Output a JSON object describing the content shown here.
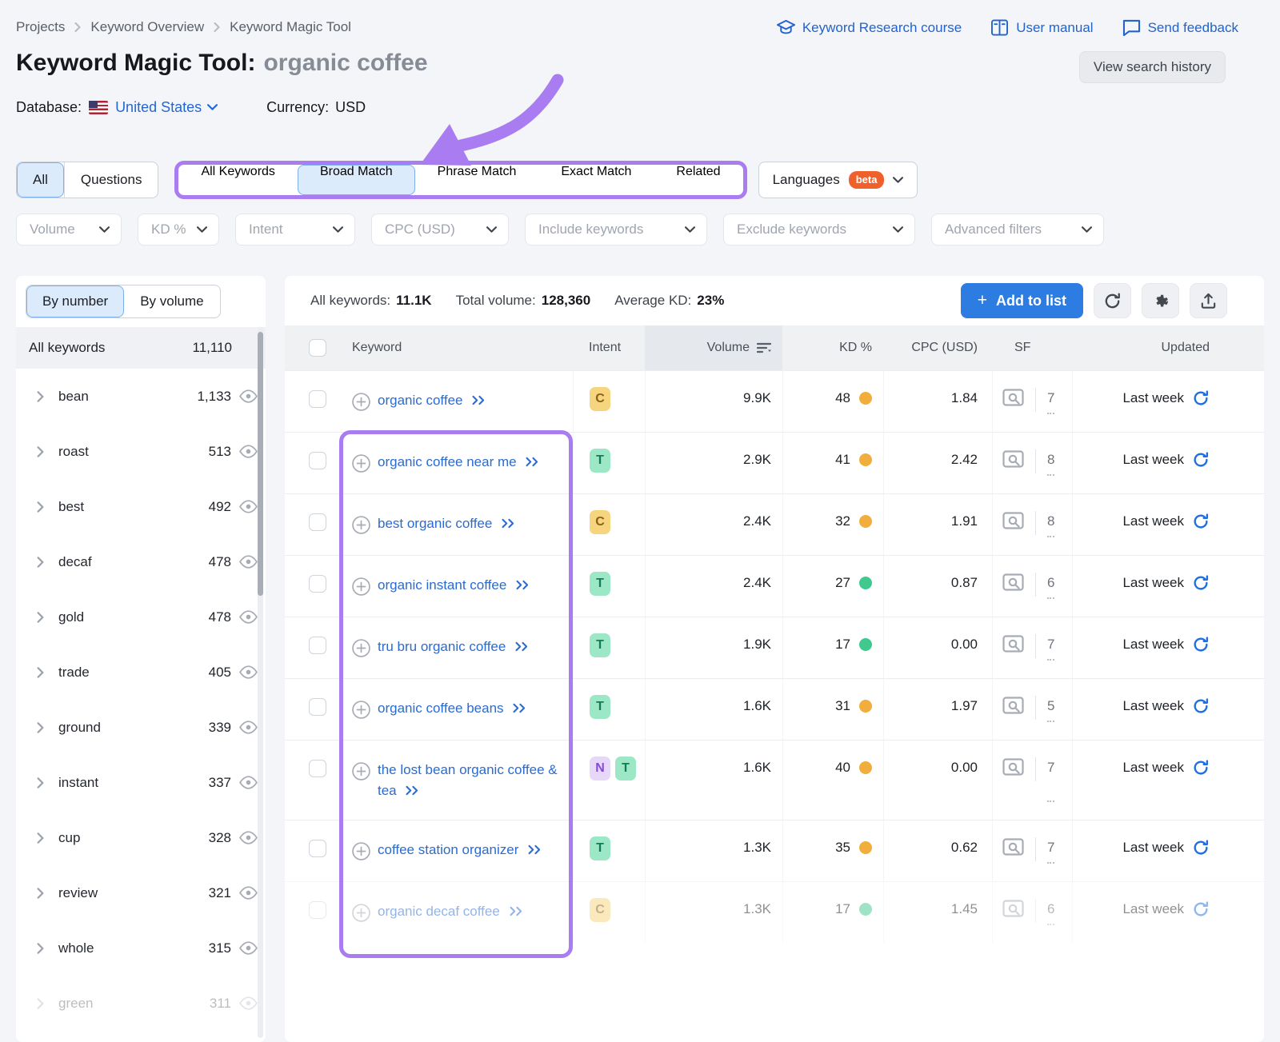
{
  "breadcrumb": {
    "items": [
      "Projects",
      "Keyword Overview",
      "Keyword Magic Tool"
    ]
  },
  "header": {
    "links": [
      {
        "label": "Keyword Research course",
        "icon": "graduation-cap-icon"
      },
      {
        "label": "User manual",
        "icon": "book-icon"
      },
      {
        "label": "Send feedback",
        "icon": "chat-icon"
      }
    ],
    "title": "Keyword Magic Tool:",
    "query": "organic coffee",
    "view_history_label": "View search history",
    "database_label": "Database:",
    "database_value": "United States",
    "currency_label": "Currency:",
    "currency_value": "USD"
  },
  "tabs": {
    "question_group": [
      {
        "label": "All",
        "selected": true
      },
      {
        "label": "Questions",
        "selected": false
      }
    ],
    "match_group": [
      {
        "label": "All Keywords",
        "selected": false
      },
      {
        "label": "Broad Match",
        "selected": true
      },
      {
        "label": "Phrase Match",
        "selected": false
      },
      {
        "label": "Exact Match",
        "selected": false
      },
      {
        "label": "Related",
        "selected": false
      }
    ],
    "languages": {
      "label": "Languages",
      "badge": "beta"
    }
  },
  "filters": [
    "Volume",
    "KD %",
    "Intent",
    "CPC (USD)",
    "Include keywords",
    "Exclude keywords",
    "Advanced filters"
  ],
  "sidebar": {
    "tabs": [
      {
        "label": "By number",
        "selected": true
      },
      {
        "label": "By volume",
        "selected": false
      }
    ],
    "all_row": {
      "label": "All keywords",
      "count": "11,110"
    },
    "groups": [
      {
        "name": "bean",
        "count": "1,133"
      },
      {
        "name": "roast",
        "count": "513"
      },
      {
        "name": "best",
        "count": "492"
      },
      {
        "name": "decaf",
        "count": "478"
      },
      {
        "name": "gold",
        "count": "478"
      },
      {
        "name": "trade",
        "count": "405"
      },
      {
        "name": "ground",
        "count": "339"
      },
      {
        "name": "instant",
        "count": "337"
      },
      {
        "name": "cup",
        "count": "328"
      },
      {
        "name": "review",
        "count": "321"
      },
      {
        "name": "whole",
        "count": "315"
      },
      {
        "name": "green",
        "count": "311",
        "faded": true
      }
    ]
  },
  "toolbar": {
    "stats": [
      {
        "label": "All keywords:",
        "value": "11.1K"
      },
      {
        "label": "Total volume:",
        "value": "128,360"
      },
      {
        "label": "Average KD:",
        "value": "23%"
      }
    ],
    "add_to_list_label": "Add to list",
    "icon_buttons": [
      "refresh-icon",
      "gear-icon",
      "export-icon"
    ]
  },
  "table": {
    "columns": [
      "Keyword",
      "Intent",
      "Volume",
      "KD %",
      "CPC (USD)",
      "SF",
      "Updated"
    ],
    "sorted_column": "Volume",
    "rows": [
      {
        "keyword": "organic coffee",
        "intents": [
          "C"
        ],
        "volume": "9.9K",
        "kd": "48",
        "kd_level": "orange",
        "cpc": "1.84",
        "sf": "7",
        "updated": "Last week"
      },
      {
        "keyword": "organic coffee near me",
        "intents": [
          "T"
        ],
        "volume": "2.9K",
        "kd": "41",
        "kd_level": "orange",
        "cpc": "2.42",
        "sf": "8",
        "updated": "Last week"
      },
      {
        "keyword": "best organic coffee",
        "intents": [
          "C"
        ],
        "volume": "2.4K",
        "kd": "32",
        "kd_level": "orange",
        "cpc": "1.91",
        "sf": "8",
        "updated": "Last week"
      },
      {
        "keyword": "organic instant coffee",
        "intents": [
          "T"
        ],
        "volume": "2.4K",
        "kd": "27",
        "kd_level": "green",
        "cpc": "0.87",
        "sf": "6",
        "updated": "Last week"
      },
      {
        "keyword": "tru bru organic coffee",
        "intents": [
          "T"
        ],
        "volume": "1.9K",
        "kd": "17",
        "kd_level": "green",
        "cpc": "0.00",
        "sf": "7",
        "updated": "Last week"
      },
      {
        "keyword": "organic coffee beans",
        "intents": [
          "T"
        ],
        "volume": "1.6K",
        "kd": "31",
        "kd_level": "orange",
        "cpc": "1.97",
        "sf": "5",
        "updated": "Last week"
      },
      {
        "keyword": "the lost bean organic coffee & tea",
        "intents": [
          "N",
          "T"
        ],
        "volume": "1.6K",
        "kd": "40",
        "kd_level": "orange",
        "cpc": "0.00",
        "sf": "7",
        "updated": "Last week"
      },
      {
        "keyword": "coffee station organizer",
        "intents": [
          "T"
        ],
        "volume": "1.3K",
        "kd": "35",
        "kd_level": "orange",
        "cpc": "0.62",
        "sf": "7",
        "updated": "Last week"
      },
      {
        "keyword": "organic decaf coffee",
        "intents": [
          "C"
        ],
        "volume": "1.3K",
        "kd": "17",
        "kd_level": "green",
        "cpc": "1.45",
        "sf": "6",
        "updated": "Last week",
        "faded": true
      }
    ]
  },
  "annotations": {
    "color": "#A97CF1",
    "match_tabs_boxed": true,
    "keyword_column_boxed": true,
    "arrow_points_to": "Broad Match"
  },
  "colors": {
    "background": "#F4F5F8",
    "link_blue": "#2264CB",
    "primary_button": "#2D7CE2",
    "annotation_purple": "#A97CF1",
    "beta_badge": "#F0602B",
    "kd_orange": "#F1AE3C",
    "kd_green": "#3FC98E",
    "selected_tab_bg": "#DCEBFB"
  }
}
